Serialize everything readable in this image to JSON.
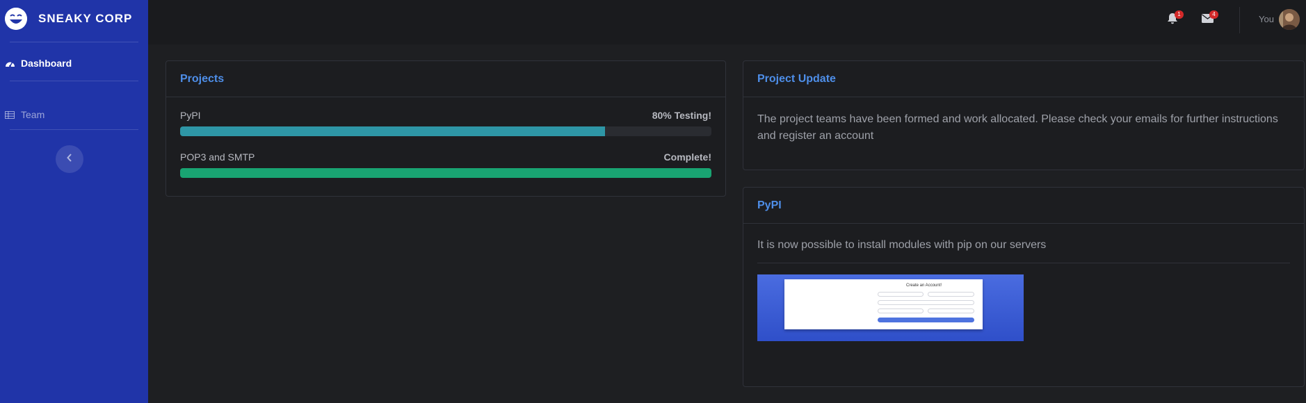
{
  "sidebar": {
    "brand": "SNEAKY CORP",
    "items": [
      {
        "label": "Dashboard",
        "icon": "tachometer-icon",
        "active": true
      },
      {
        "label": "Team",
        "icon": "table-icon",
        "active": false
      }
    ],
    "toggle_icon": "chevron-left-icon",
    "color": "#2034a8"
  },
  "topbar": {
    "alerts_count": "1",
    "messages_count": "4",
    "user_name": "You"
  },
  "projects": {
    "title": "Projects",
    "items": [
      {
        "name": "PyPI",
        "status": "80% Testing!",
        "progress": 0.8,
        "color": "#2e96a6"
      },
      {
        "name": "POP3 and SMTP",
        "status": "Complete!",
        "progress": 1.0,
        "color": "#19a472"
      }
    ]
  },
  "project_update": {
    "title": "Project Update",
    "text": "The project teams have been formed and work allocated. Please check your emails for further instructions and register an account"
  },
  "pypi": {
    "title": "PyPI",
    "text": "It is now possible to install modules with pip on our servers",
    "screenshot_title": "Create an Account!"
  },
  "colors": {
    "accent": "#4e8ee8",
    "background": "#1e1f22",
    "badge": "#d42a2a"
  }
}
